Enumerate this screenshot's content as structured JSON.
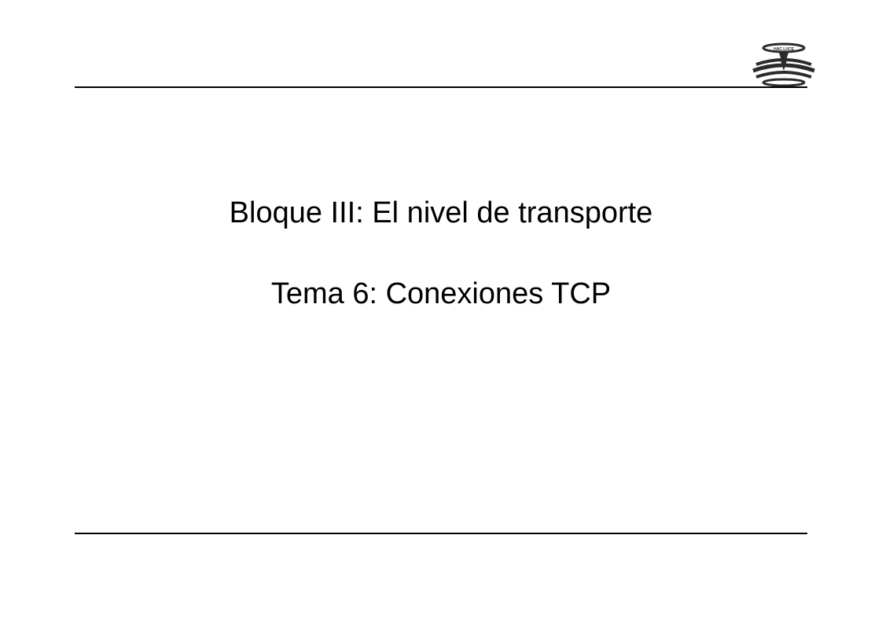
{
  "slide": {
    "title_line1": "Bloque III: El nivel de transporte",
    "title_line2": "Tema 6: Conexiones TCP"
  },
  "logo": {
    "name": "institution-logo"
  }
}
